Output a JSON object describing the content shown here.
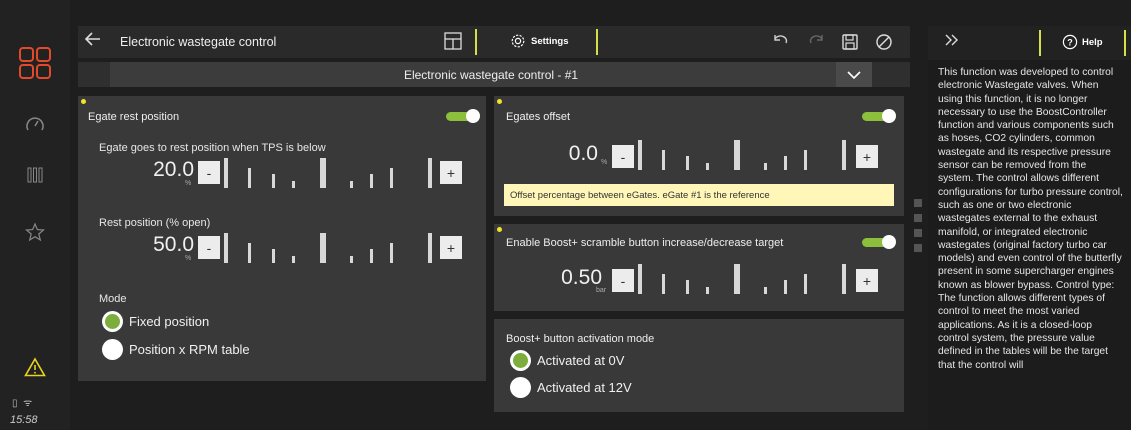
{
  "sidebar": {
    "icons": [
      "apps-icon",
      "gauge-icon",
      "bars-icon",
      "star-icon",
      "warning-icon"
    ],
    "time": "15:58"
  },
  "topbar": {
    "title": "Electronic wastegate control",
    "settings_label": "Settings"
  },
  "dropdown": {
    "selected": "Electronic wastegate control - #1"
  },
  "left_card": {
    "title": "Egate rest position",
    "toggle_on": true,
    "field1": {
      "label": "Egate goes to rest position when TPS is below",
      "value": "20.0",
      "unit": "%"
    },
    "field2": {
      "label": "Rest position (% open)",
      "value": "50.0",
      "unit": "%"
    },
    "mode": {
      "label": "Mode",
      "options": [
        "Fixed position",
        "Position x RPM table"
      ],
      "selected_index": 0
    }
  },
  "offset_card": {
    "title": "Egates offset",
    "toggle_on": true,
    "value": "0.0",
    "unit": "%",
    "note": "Offset percentage between eGates. eGate #1 is the reference"
  },
  "boost_card": {
    "title": "Enable Boost+ scramble button increase/decrease target",
    "toggle_on": true,
    "value": "0.50",
    "unit": "bar"
  },
  "activation_card": {
    "title": "Boost+ button activation mode",
    "options": [
      "Activated at 0V",
      "Activated at 12V"
    ],
    "selected_index": 0
  },
  "stepper": {
    "minus": "-",
    "plus": "+"
  },
  "help": {
    "label": "Help",
    "text": "This function was developed to control electronic Wastegate valves. When using this function, it is no longer necessary to use the BoostController function and various components such as hoses, CO2 cylinders, common wastegate and its respective pressure sensor can be removed from the system. The control allows different configurations for turbo pressure control, such as one or two electronic wastegates external to the exhaust manifold, or integrated electronic wastegates (original factory turbo car models) and even control of the butterfly present in some supercharger engines known as blower bypass. Control type: The function allows different types of control to meet the most varied applications. As it is a closed-loop control system, the pressure value defined in the tables will be the target that the control will"
  }
}
